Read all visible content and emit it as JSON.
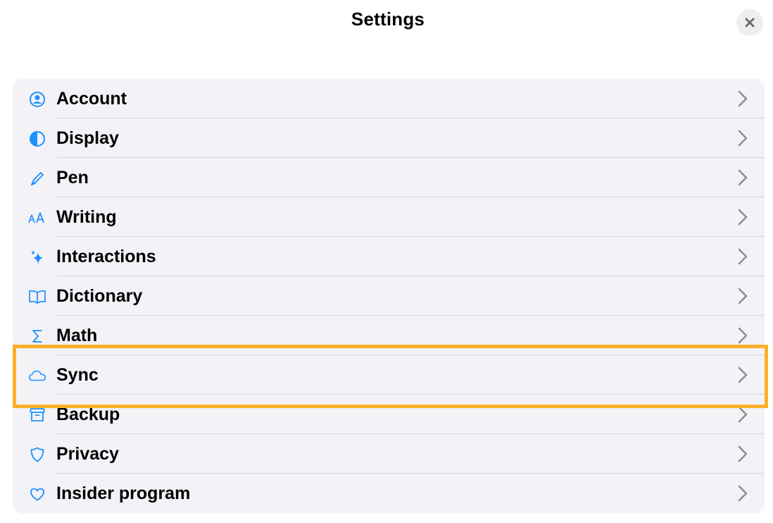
{
  "header": {
    "title": "Settings",
    "close_icon": "close-icon"
  },
  "settings": {
    "items": [
      {
        "label": "Account",
        "icon": "person-circle-icon"
      },
      {
        "label": "Display",
        "icon": "half-circle-icon"
      },
      {
        "label": "Pen",
        "icon": "pen-icon"
      },
      {
        "label": "Writing",
        "icon": "text-size-icon"
      },
      {
        "label": "Interactions",
        "icon": "sparkles-icon"
      },
      {
        "label": "Dictionary",
        "icon": "book-icon"
      },
      {
        "label": "Math",
        "icon": "sigma-icon"
      },
      {
        "label": "Sync",
        "icon": "cloud-icon"
      },
      {
        "label": "Backup",
        "icon": "archive-box-icon"
      },
      {
        "label": "Privacy",
        "icon": "shield-icon"
      },
      {
        "label": "Insider program",
        "icon": "heart-icon"
      }
    ]
  },
  "colors": {
    "accent": "#1e90ff",
    "highlight": "#fbb02a",
    "chevron": "#8e8e93",
    "list_background": "#f2f2f7"
  }
}
